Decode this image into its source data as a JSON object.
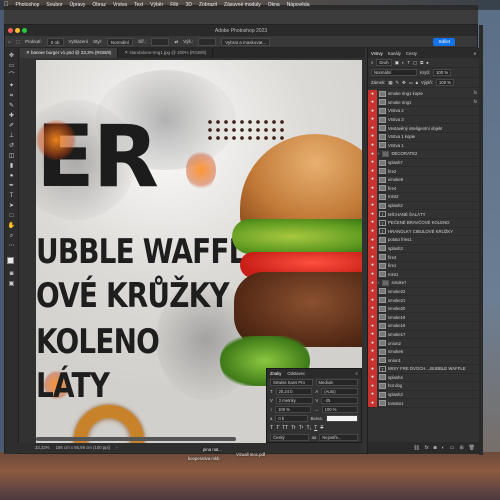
{
  "menubar": {
    "items": [
      "Photoshop",
      "Soubor",
      "Úpravy",
      "Obraz",
      "Vrstva",
      "Text",
      "Výběr",
      "Filtr",
      "3D",
      "Zobrazit",
      "Zásuvné moduly",
      "Okna",
      "Nápověda"
    ]
  },
  "window": {
    "title": "Adobe Photoshop 2023"
  },
  "options_bar": {
    "prutok_label": "Prolnutí:",
    "prutok_value": "0 ob",
    "vyhlazeni": "Vyhlazení",
    "styl_label": "Styl:",
    "styl_value": "Normální",
    "sirka_label": "Šíř.:",
    "vyska_label": "Výš.:",
    "mask_button": "Vybrat a maskovat...",
    "share_button": "Sdílet"
  },
  "doc_tabs": [
    {
      "label": "banner burger v1.psd @ 33,3% (RGB/8)",
      "active": true
    },
    {
      "label": "standalone-img1.jpg @ 100% (RGB/8)",
      "active": false
    }
  ],
  "canvas": {
    "big_letters": "ER",
    "line1": "UBBLE WAFFLE",
    "line2": "OVÉ KRŮŽKY",
    "line3": "KOLENO",
    "line4": "LÁTY"
  },
  "char_panel": {
    "tab_active": "Znaky",
    "tab_other": "Odstavec",
    "font_family": "Strwiss Sans Pro",
    "font_style": "Medium",
    "size": "20,24 b",
    "leading": "(Auto)",
    "kerning": "2 metriky",
    "tracking": "-25",
    "vscale": "100 %",
    "hscale": "100 %",
    "baseline": "0 b",
    "color_label": "Barva:",
    "glyphs": [
      "T",
      "T",
      "TT",
      "Tr",
      "T¹",
      "T₁",
      "T",
      "T"
    ],
    "language": "Český",
    "aa": "Nejostře..."
  },
  "layers_panel": {
    "tabs": [
      "Vrstvy",
      "Kanály",
      "Cesty"
    ],
    "filter_label": "Druh",
    "blend_mode": "Normální",
    "opacity_label": "Krytí:",
    "opacity_value": "100 %",
    "lock_label": "Zámek:",
    "fill_label": "Výplň:",
    "fill_value": "100 %",
    "layers": [
      {
        "name": "smoke ring1 kopie",
        "fx": true,
        "thumb": "img"
      },
      {
        "name": "smoke ring1",
        "fx": true,
        "thumb": "img"
      },
      {
        "name": "Vrstva 2",
        "fx": false,
        "thumb": "img"
      },
      {
        "name": "Vrstva 3",
        "fx": false,
        "thumb": "img"
      },
      {
        "name": "Vestavěný inteligentní objekt",
        "fx": false,
        "thumb": "img"
      },
      {
        "name": "Vrstva 1 kopie",
        "fx": false,
        "thumb": "img"
      },
      {
        "name": "Vrstva 1",
        "fx": false,
        "thumb": "img"
      },
      {
        "name": "DECORATE2",
        "fx": false,
        "thumb": "folder"
      },
      {
        "name": "splash7",
        "fx": false,
        "thumb": "img"
      },
      {
        "name": "fire2",
        "fx": false,
        "thumb": "img"
      },
      {
        "name": "smoke9",
        "fx": false,
        "thumb": "img"
      },
      {
        "name": "fire4",
        "fx": false,
        "thumb": "img"
      },
      {
        "name": "mint2",
        "fx": false,
        "thumb": "img"
      },
      {
        "name": "splash2",
        "fx": false,
        "thumb": "img"
      },
      {
        "name": "MÍCHANÉ ŠALÁTY",
        "fx": false,
        "thumb": "T"
      },
      {
        "name": "PEČENÉ BRAVČOVÉ KOLENO",
        "fx": false,
        "thumb": "T"
      },
      {
        "name": "HRANOLKY    CIBULOVÉ KRÚŽKY",
        "fx": false,
        "thumb": "T"
      },
      {
        "name": "potato fries1",
        "fx": false,
        "thumb": "img"
      },
      {
        "name": "splash3",
        "fx": false,
        "thumb": "img"
      },
      {
        "name": "fire3",
        "fx": false,
        "thumb": "img"
      },
      {
        "name": "fire1",
        "fx": false,
        "thumb": "img"
      },
      {
        "name": "mint1",
        "fx": false,
        "thumb": "img"
      },
      {
        "name": "smoke7",
        "fx": false,
        "thumb": "folder"
      },
      {
        "name": "smoke22",
        "fx": false,
        "thumb": "img"
      },
      {
        "name": "smoke21",
        "fx": false,
        "thumb": "img"
      },
      {
        "name": "smoke20",
        "fx": false,
        "thumb": "img"
      },
      {
        "name": "smoke19",
        "fx": false,
        "thumb": "img"
      },
      {
        "name": "smoke18",
        "fx": false,
        "thumb": "img"
      },
      {
        "name": "smoke17",
        "fx": false,
        "thumb": "img"
      },
      {
        "name": "onion2",
        "fx": false,
        "thumb": "img"
      },
      {
        "name": "smoke6",
        "fx": false,
        "thumb": "img"
      },
      {
        "name": "onion1",
        "fx": false,
        "thumb": "img"
      },
      {
        "name": "WISY FRE DVOCH....BUBBLE WAFFLE",
        "fx": false,
        "thumb": "T"
      },
      {
        "name": "splash4",
        "fx": false,
        "thumb": "img"
      },
      {
        "name": "hot dog",
        "fx": false,
        "thumb": "img"
      },
      {
        "name": "splash3",
        "fx": false,
        "thumb": "img"
      },
      {
        "name": "tomato1",
        "fx": false,
        "thumb": "img"
      }
    ],
    "bottom_icons": [
      "link-icon",
      "fx-icon",
      "mask-icon",
      "adjustment-icon",
      "folder-icon",
      "new-layer-icon",
      "trash-icon"
    ]
  },
  "status_bar": {
    "zoom": "33,33%",
    "doc_size": "186 cm x 65,99 cm (100 ppi)"
  },
  "dock_labels": {
    "label1": "pina nat...",
    "label2": "kooperativa.mkb",
    "label3": "Vizuall moc.pdf"
  },
  "colors": {
    "accent_blue": "#1473e6",
    "eye_red": "#c8332f",
    "panel_bg": "#323232"
  }
}
